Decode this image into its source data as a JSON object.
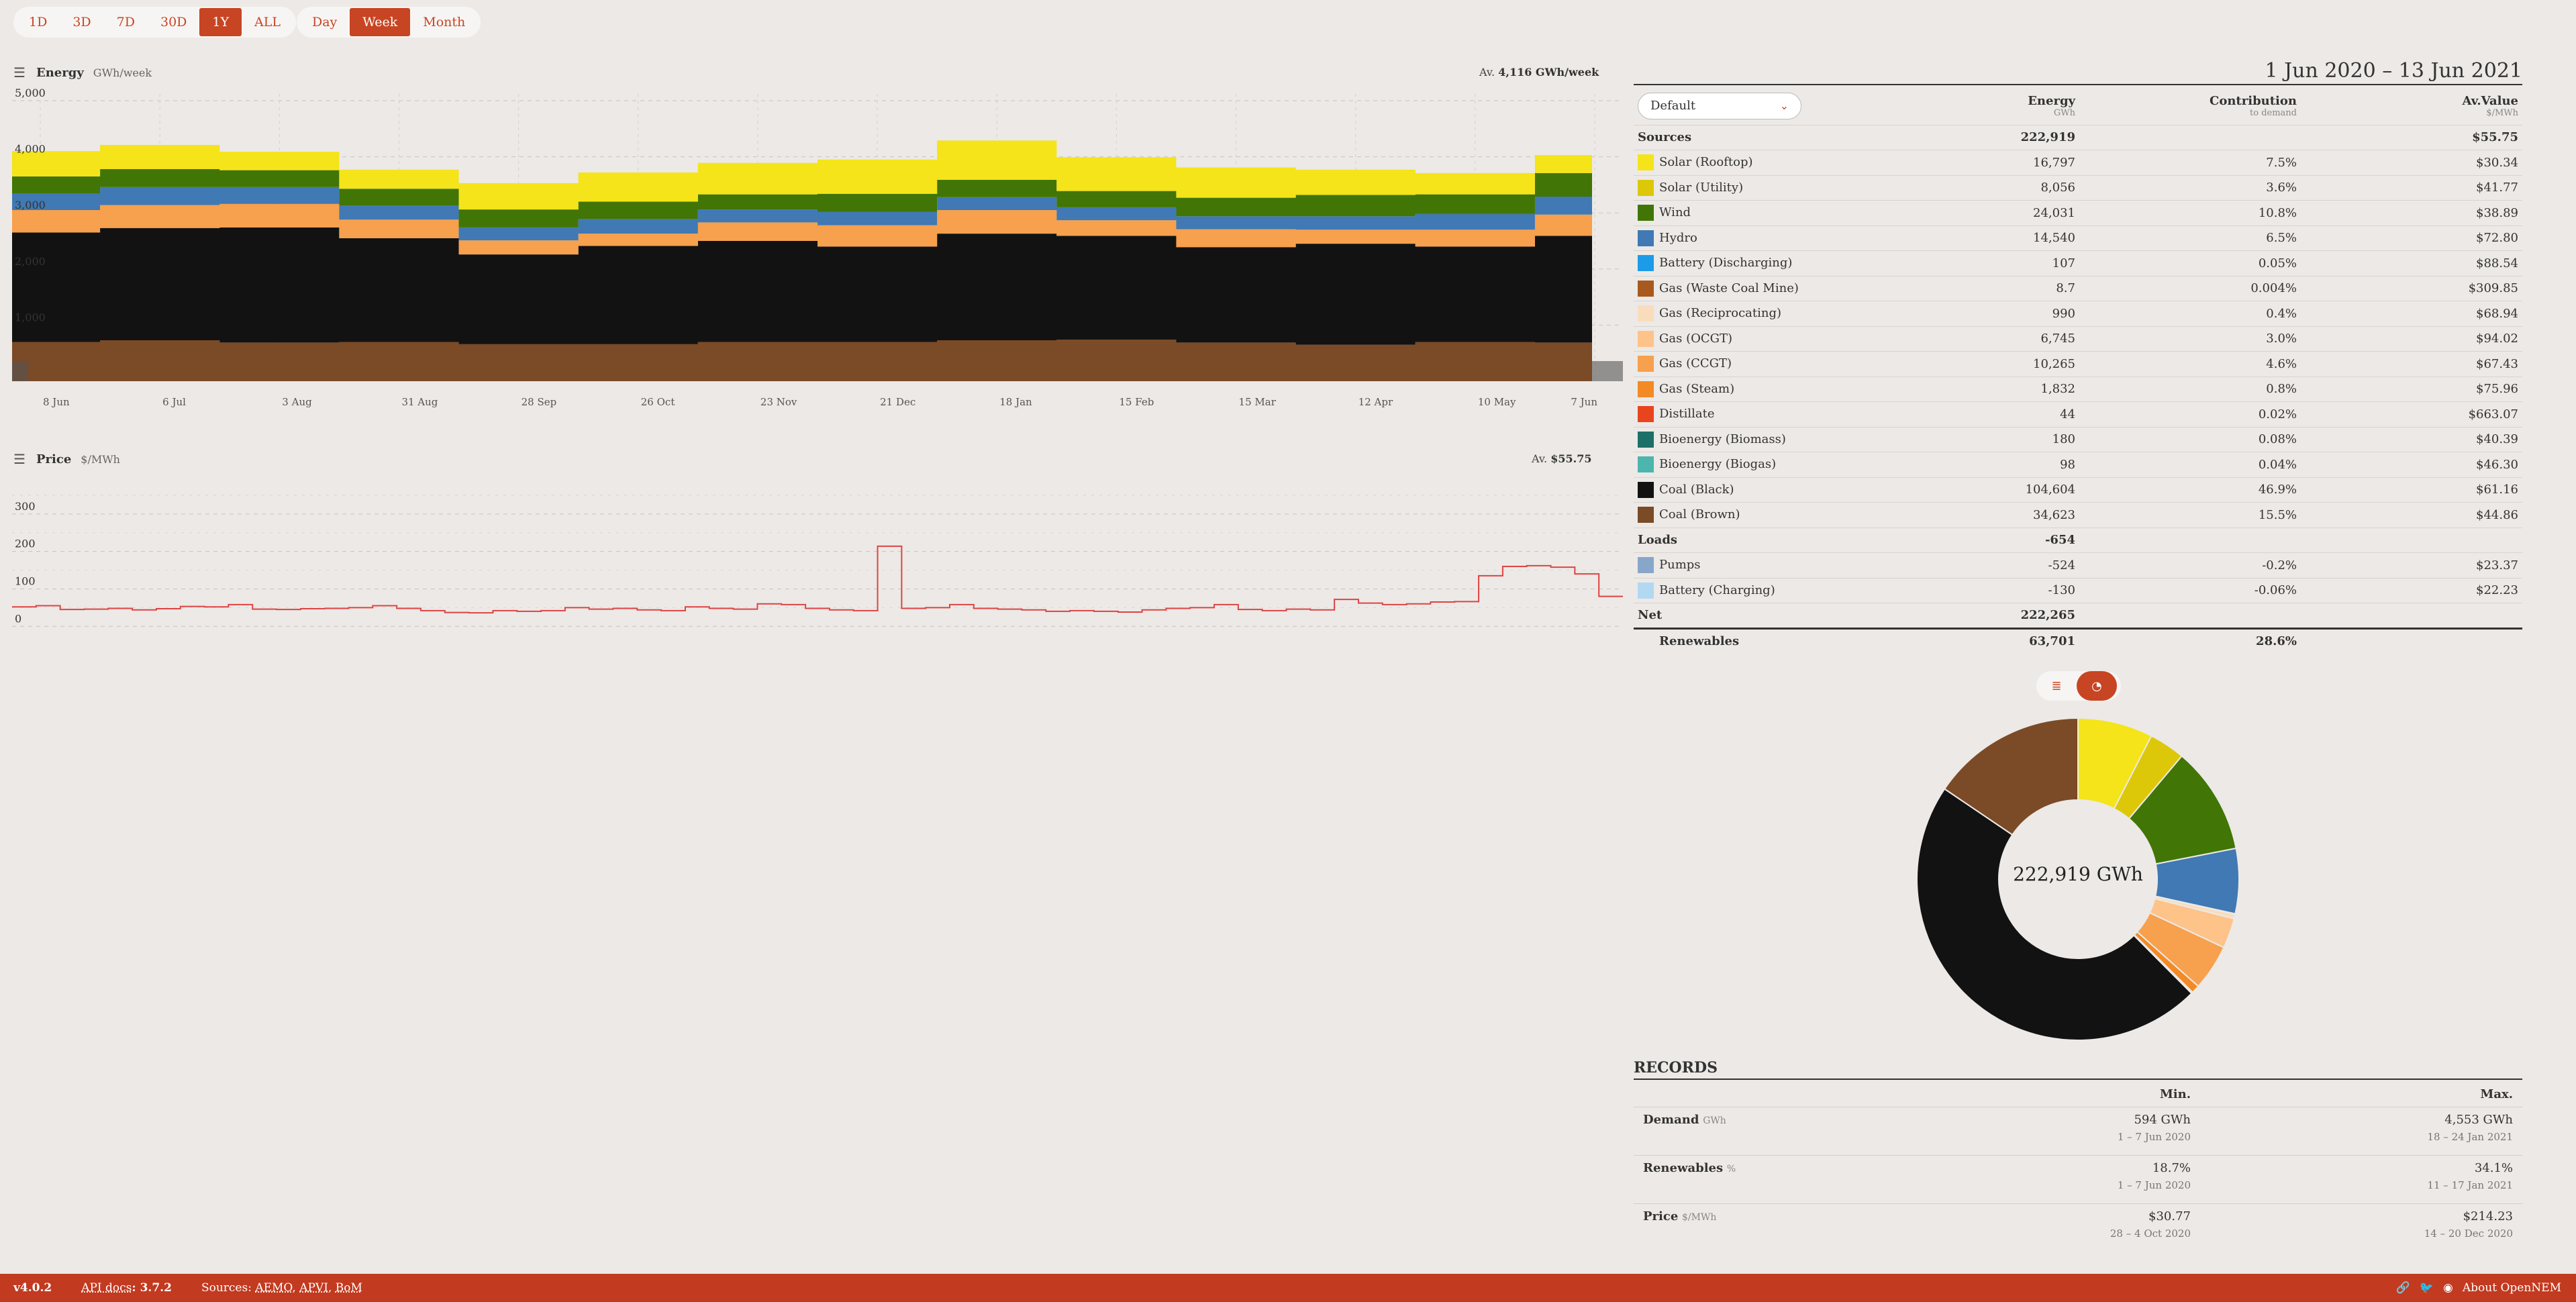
{
  "ranges": [
    "1D",
    "3D",
    "7D",
    "30D",
    "1Y",
    "ALL"
  ],
  "range_active": "1Y",
  "intervals": [
    "Day",
    "Week",
    "Month"
  ],
  "interval_active": "Week",
  "energy": {
    "title": "Energy",
    "unit": "GWh/week",
    "avg_prefix": "Av.",
    "avg_value": "4,116 GWh/week",
    "y_ticks": [
      "5,000",
      "4,000",
      "3,000",
      "2,000",
      "1,000"
    ],
    "x_ticks": [
      "8 Jun",
      "6 Jul",
      "3 Aug",
      "31 Aug",
      "28 Sep",
      "26 Oct",
      "23 Nov",
      "21 Dec",
      "18 Jan",
      "15 Feb",
      "15 Mar",
      "12 Apr",
      "10 May",
      "7 Jun"
    ]
  },
  "price": {
    "title": "Price",
    "unit": "$/MWh",
    "avg_prefix": "Av.",
    "avg_value": "$55.75",
    "y_ticks": [
      "300",
      "200",
      "100",
      "0"
    ]
  },
  "chart_data": [
    {
      "type": "area",
      "title": "Energy",
      "ylabel": "GWh/week",
      "ylim": [
        0,
        5000
      ],
      "x": [
        "8 Jun",
        "6 Jul",
        "3 Aug",
        "31 Aug",
        "28 Sep",
        "26 Oct",
        "23 Nov",
        "21 Dec",
        "18 Jan",
        "15 Feb",
        "15 Mar",
        "12 Apr",
        "10 May",
        "7 Jun"
      ],
      "series": [
        {
          "name": "Coal (Brown)",
          "color": "#7b4a26",
          "values": [
            700,
            730,
            690,
            700,
            660,
            660,
            700,
            700,
            730,
            740,
            690,
            650,
            700,
            690
          ]
        },
        {
          "name": "Coal (Black)",
          "color": "#121212",
          "values": [
            1950,
            2000,
            2050,
            1850,
            1600,
            1750,
            1800,
            1700,
            1900,
            1850,
            1700,
            1800,
            1700,
            1900
          ]
        },
        {
          "name": "Gas",
          "color": "#f7a04d",
          "values": [
            400,
            410,
            420,
            330,
            250,
            220,
            330,
            380,
            420,
            280,
            320,
            250,
            300,
            380
          ]
        },
        {
          "name": "Hydro",
          "color": "#4079b3",
          "values": [
            300,
            320,
            300,
            250,
            230,
            260,
            230,
            240,
            230,
            230,
            230,
            240,
            280,
            320
          ]
        },
        {
          "name": "Wind",
          "color": "#417505",
          "values": [
            300,
            320,
            300,
            300,
            320,
            310,
            270,
            320,
            310,
            290,
            330,
            380,
            350,
            420
          ]
        },
        {
          "name": "Solar",
          "color": "#f4e419",
          "values": [
            450,
            430,
            330,
            340,
            470,
            520,
            560,
            610,
            700,
            600,
            540,
            450,
            380,
            320
          ]
        }
      ]
    },
    {
      "type": "line",
      "title": "Price",
      "ylabel": "$/MWh",
      "ylim": [
        -30,
        400
      ],
      "series": [
        {
          "name": "Price",
          "color": "#d44",
          "values": [
            52,
            55,
            45,
            46,
            48,
            44,
            47,
            53,
            52,
            58,
            46,
            45,
            47,
            48,
            50,
            55,
            48,
            42,
            37,
            36,
            42,
            40,
            42,
            50,
            46,
            48,
            44,
            42,
            52,
            48,
            46,
            60,
            58,
            48,
            44,
            42,
            214,
            48,
            50,
            58,
            48,
            46,
            44,
            40,
            42,
            40,
            38,
            44,
            48,
            50,
            58,
            45,
            42,
            46,
            44,
            72,
            62,
            58,
            60,
            65,
            66,
            135,
            160,
            162,
            158,
            140,
            80
          ]
        }
      ]
    }
  ],
  "panel": {
    "date_range": "1 Jun 2020 – 13 Jun 2021",
    "dropdown_value": "Default",
    "col_energy": "Energy",
    "col_energy_unit": "GWh",
    "col_contrib": "Contribution",
    "col_contrib_sub": "to demand",
    "col_av": "Av.Value",
    "col_av_unit": "$/MWh",
    "sources_label": "Sources",
    "sources_energy": "222,919",
    "sources_av": "$55.75",
    "sources": [
      {
        "name": "Solar (Rooftop)",
        "color": "#f4e419",
        "energy": "16,797",
        "contrib": "7.5%",
        "av": "$30.34"
      },
      {
        "name": "Solar (Utility)",
        "color": "#dcc808",
        "energy": "8,056",
        "contrib": "3.6%",
        "av": "$41.77"
      },
      {
        "name": "Wind",
        "color": "#417505",
        "energy": "24,031",
        "contrib": "10.8%",
        "av": "$38.89"
      },
      {
        "name": "Hydro",
        "color": "#4079b3",
        "energy": "14,540",
        "contrib": "6.5%",
        "av": "$72.80"
      },
      {
        "name": "Battery (Discharging)",
        "color": "#1c9be8",
        "energy": "107",
        "contrib": "0.05%",
        "av": "$88.54"
      },
      {
        "name": "Gas (Waste Coal Mine)",
        "color": "#a8591e",
        "energy": "8.7",
        "contrib": "0.004%",
        "av": "$309.85"
      },
      {
        "name": "Gas (Reciprocating)",
        "color": "#f9dcbc",
        "energy": "990",
        "contrib": "0.4%",
        "av": "$68.94"
      },
      {
        "name": "Gas (OCGT)",
        "color": "#fdc389",
        "energy": "6,745",
        "contrib": "3.0%",
        "av": "$94.02"
      },
      {
        "name": "Gas (CCGT)",
        "color": "#f7a04d",
        "energy": "10,265",
        "contrib": "4.6%",
        "av": "$67.43"
      },
      {
        "name": "Gas (Steam)",
        "color": "#f28a26",
        "energy": "1,832",
        "contrib": "0.8%",
        "av": "$75.96"
      },
      {
        "name": "Distillate",
        "color": "#e8451f",
        "energy": "44",
        "contrib": "0.02%",
        "av": "$663.07"
      },
      {
        "name": "Bioenergy (Biomass)",
        "color": "#1d7068",
        "energy": "180",
        "contrib": "0.08%",
        "av": "$40.39"
      },
      {
        "name": "Bioenergy (Biogas)",
        "color": "#4cb5ae",
        "energy": "98",
        "contrib": "0.04%",
        "av": "$46.30"
      },
      {
        "name": "Coal (Black)",
        "color": "#121212",
        "energy": "104,604",
        "contrib": "46.9%",
        "av": "$61.16"
      },
      {
        "name": "Coal (Brown)",
        "color": "#7b4a26",
        "energy": "34,623",
        "contrib": "15.5%",
        "av": "$44.86"
      }
    ],
    "loads_label": "Loads",
    "loads_energy": "-654",
    "loads": [
      {
        "name": "Pumps",
        "color": "#88a6c8",
        "energy": "-524",
        "contrib": "-0.2%",
        "av": "$23.37"
      },
      {
        "name": "Battery (Charging)",
        "color": "#b2d8f2",
        "energy": "-130",
        "contrib": "-0.06%",
        "av": "$22.23"
      }
    ],
    "net_label": "Net",
    "net_energy": "222,265",
    "renewables_label": "Renewables",
    "renewables_energy": "63,701",
    "renewables_contrib": "28.6%",
    "donut_center": "222,919 GWh"
  },
  "records": {
    "title": "RECORDS",
    "col_min": "Min.",
    "col_max": "Max.",
    "rows": [
      {
        "label": "Demand",
        "unit": "GWh",
        "min": "594 GWh",
        "min_date": "1 – 7 Jun 2020",
        "max": "4,553 GWh",
        "max_date": "18 – 24 Jan 2021"
      },
      {
        "label": "Renewables",
        "unit": "%",
        "min": "18.7%",
        "min_date": "1 – 7 Jun 2020",
        "max": "34.1%",
        "max_date": "11 – 17 Jan 2021"
      },
      {
        "label": "Price",
        "unit": "$/MWh",
        "min": "$30.77",
        "min_date": "28 – 4 Oct 2020",
        "max": "$214.23",
        "max_date": "14 – 20 Dec 2020"
      }
    ]
  },
  "footer": {
    "version": "v4.0.2",
    "api_label": "API docs",
    "api_version": ": 3.7.2",
    "sources_label": "Sources:",
    "sources": [
      "AEMO",
      "APVI",
      "BoM"
    ],
    "about": "About OpenNEM"
  }
}
